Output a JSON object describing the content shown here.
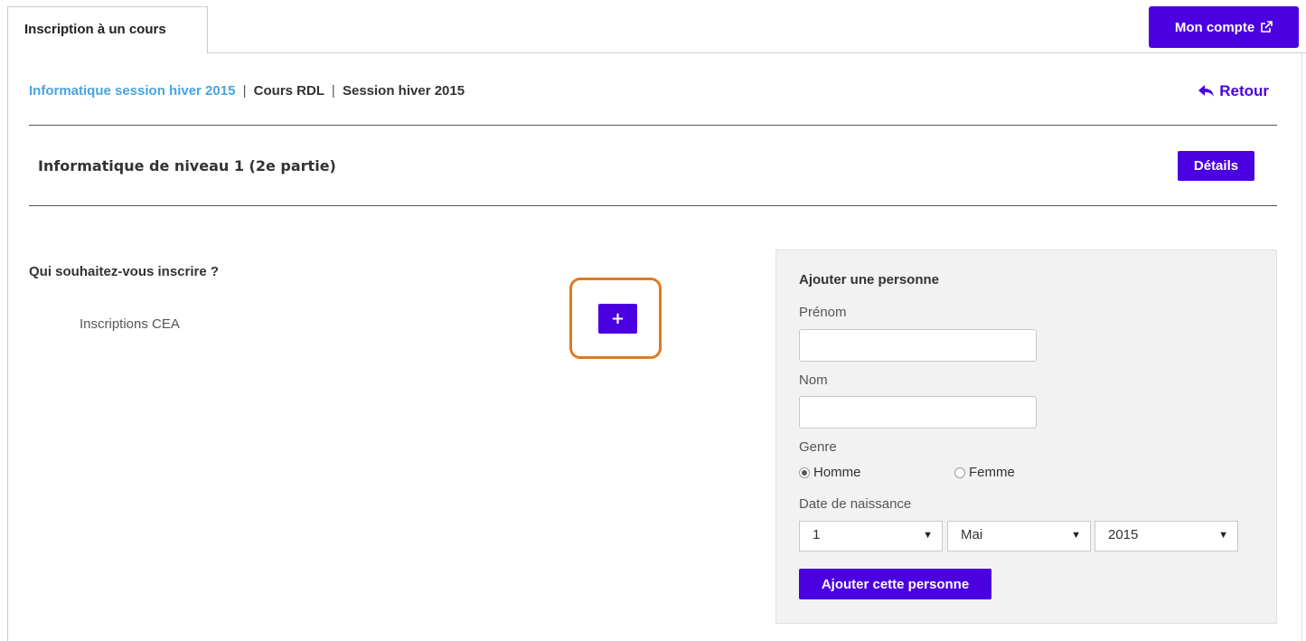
{
  "tabs": [
    {
      "label": "Inscription à un cours",
      "active": true
    }
  ],
  "header": {
    "account_label": "Mon compte",
    "account_icon": "external-link-icon"
  },
  "breadcrumb": {
    "link": "Informatique session hiver 2015",
    "separator": "|",
    "course": "Cours RDL",
    "session": "Session hiver 2015"
  },
  "back": {
    "label": "Retour",
    "icon": "reply-arrow-icon"
  },
  "course": {
    "title": "Informatique de niveau 1 (2e partie)",
    "details_label": "Détails"
  },
  "main": {
    "question": "Qui souhaitez-vous inscrire ?",
    "group_label": "Inscriptions CEA",
    "add_label": "+"
  },
  "form": {
    "title": "Ajouter une personne",
    "firstname_label": "Prénom",
    "firstname_value": "",
    "lastname_label": "Nom",
    "lastname_value": "",
    "gender_label": "Genre",
    "gender_options": [
      "Homme",
      "Femme"
    ],
    "gender_selected": "Homme",
    "birthdate_label": "Date de naissance",
    "day": "1",
    "month": "Mai",
    "year": "2015",
    "submit_label": "Ajouter cette personne"
  },
  "colors": {
    "accent": "#4a00e0",
    "link": "#4aa3df",
    "highlight": "#e07a1f",
    "panel_bg": "#f2f2f2"
  }
}
